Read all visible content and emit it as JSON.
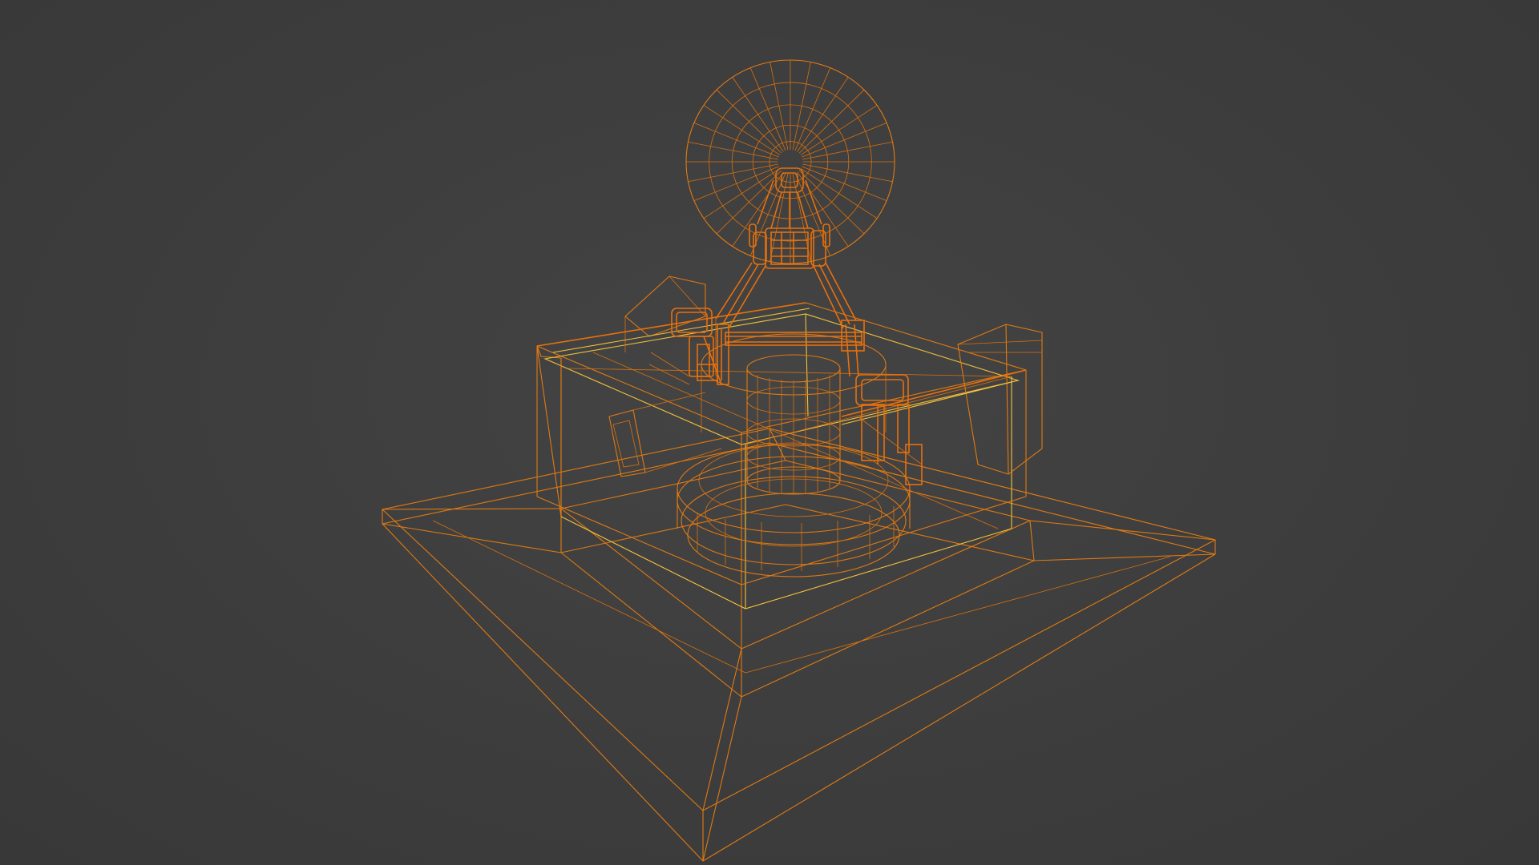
{
  "viewport": {
    "mode": "wireframe",
    "background_color": "#3d3d3d",
    "wire_color": "#e07a12",
    "active_edge_color": "#f5c23a"
  },
  "scene": {
    "object": "satellite-dish-station-model"
  }
}
